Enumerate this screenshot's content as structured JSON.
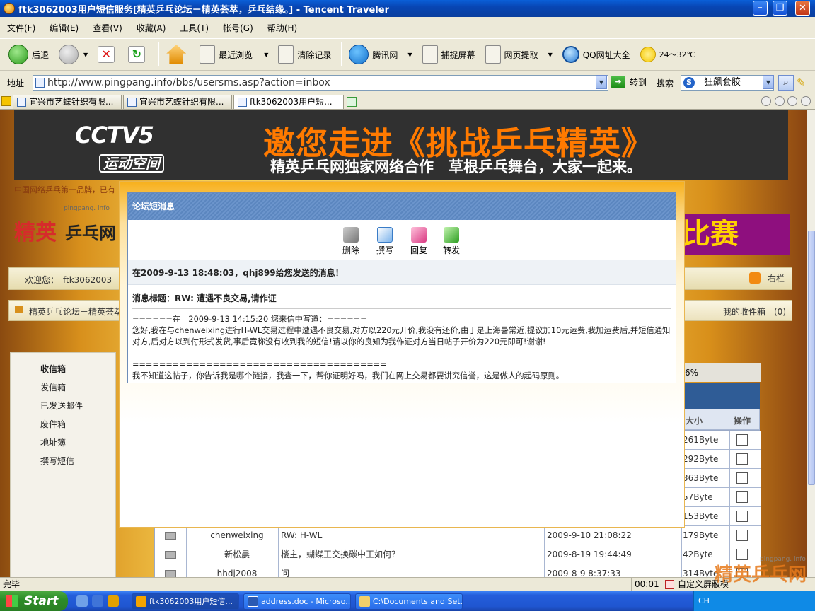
{
  "window": {
    "title": "ftk3062003用户短信服务[精英乒乓论坛－精英荟萃，乒乓结缘。] - Tencent Traveler",
    "minimize": "–",
    "maximize": "❐",
    "close": "✕"
  },
  "menu": [
    "文件(F)",
    "编辑(E)",
    "查看(V)",
    "收藏(A)",
    "工具(T)",
    "帐号(G)",
    "帮助(H)"
  ],
  "toolbar": {
    "back": "后退",
    "recent": "最近浏览",
    "clear": "清除记录",
    "tencent": "腾讯网",
    "capture": "捕捉屏幕",
    "extract": "网页提取",
    "qq_sites": "QQ网址大全",
    "weather": "24～32℃"
  },
  "address": {
    "label": "地址",
    "url": "http://www.pingpang.info/bbs/usersms.asp?action=inbox",
    "go": "转到",
    "search_label": "搜索",
    "search_value": "狂飙套胶",
    "search_engine_glyph": "S"
  },
  "tabs": [
    {
      "label": "宜兴市艺蝶针织有限..."
    },
    {
      "label": "宜兴市艺蝶针织有限..."
    },
    {
      "label": "ftk3062003用户短...",
      "close": "✕"
    }
  ],
  "page": {
    "banner_logo": "CCTV5",
    "banner_logo_sub": "运动空间",
    "banner_title": "邀您走进《挑战乒乓精英》",
    "banner_subtitle": "精英乒乓网独家网络合作　草根乒乓舞台，大家一起来。",
    "tagline": "中国网络乒乓第一品牌，已有",
    "logo_small": "pingpang. info",
    "logo_main": "精英",
    "logo_main2": "乒乓网",
    "promo": "比赛",
    "welcome": "欢迎您：　ftk3062003　随",
    "right_col": "右栏",
    "crumb": "精英乒乓论坛－精英荟萃",
    "my_inbox": "我的收件箱　(0)",
    "left_menu": [
      "收信箱",
      "发信箱",
      "已发送邮件",
      "废件箱",
      "地址簿",
      "撰写短信"
    ],
    "usage_pct": "6%",
    "col_size": "大小",
    "col_action": "操作",
    "rows": [
      {
        "sender": "",
        "subject": "",
        "date": "",
        "size": "261Byte"
      },
      {
        "sender": "",
        "subject": "",
        "date": "",
        "size": "292Byte"
      },
      {
        "sender": "",
        "subject": "",
        "date": "",
        "size": "363Byte"
      },
      {
        "sender": "",
        "subject": "",
        "date": "",
        "size": "57Byte"
      },
      {
        "sender": "",
        "subject": "",
        "date": "",
        "size": "153Byte"
      },
      {
        "sender": "chenweixing",
        "subject": "RW: H-WL",
        "date": "2009-9-10 21:08:22",
        "size": "179Byte"
      },
      {
        "sender": "新松晨",
        "subject": "楼主，蝴蝶王交换碳中王如何？",
        "date": "2009-8-19 19:44:49",
        "size": "42Byte"
      },
      {
        "sender": "hhdj2008",
        "subject": "问",
        "date": "2009-8-9 8:37:33",
        "size": "314Byte"
      }
    ]
  },
  "modal": {
    "title": "论坛短消息",
    "actions": [
      "删除",
      "撰写",
      "回复",
      "转发"
    ],
    "from": "在2009-9-13 18:48:03，qhj899给您发送的消息！",
    "subject": "消息标题：RW: 遭遇不良交易,请作证",
    "body_line1": "======在　2009-9-13 14:15:20 您来信中写道：======",
    "body_line2": "您好,我在与chenweixing进行H-WL交易过程中遭遇不良交易,对方以220元开价,我没有还价,由于是上海暑常近,提议加10元运费,我加运费后,并短信通知对方,后对方以到付形式发货,事后竟称没有收到我的短信!请以你的良知为我作证对方当日帖子开价为220元即可!谢谢!",
    "body_line3": "======================================",
    "body_line4": "我不知道这帖子，你告诉我是哪个链接，我查一下，帮你证明好吗，我们在网上交易都要讲究信誉，这是做人的起码原则。"
  },
  "status": {
    "text": "完毕",
    "time": "00:01",
    "custom": "自定义屏蔽模"
  },
  "watermark": {
    "main": "精英乒乓网",
    "small": "pingpang. info"
  },
  "taskbar": {
    "start": "Start",
    "tasks": [
      "ftk3062003用户短信...",
      "address.doc - Microso...",
      "C:\\Documents and Set..."
    ],
    "tray": "CH"
  },
  "colors": {
    "title_blue": "#0846b4",
    "modal_head": "#5b86bf",
    "banner_orange": "#ff7a00",
    "promo_purple": "#8e0f7e"
  }
}
